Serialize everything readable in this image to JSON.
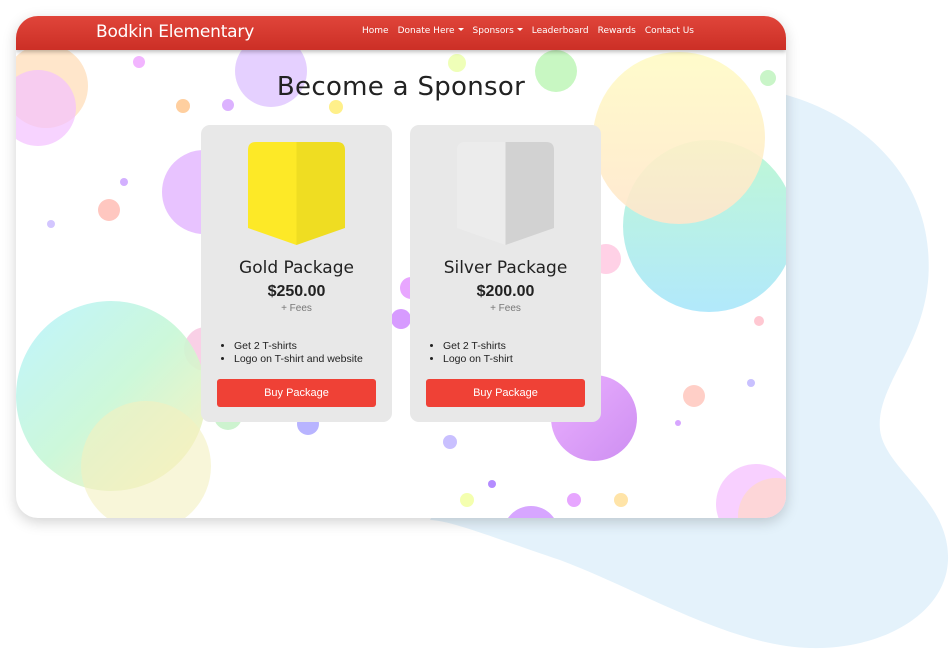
{
  "navbar": {
    "brand": "Bodkin Elementary",
    "items": [
      {
        "label": "Home",
        "has_dropdown": false
      },
      {
        "label": "Donate Here",
        "has_dropdown": true
      },
      {
        "label": "Sponsors",
        "has_dropdown": true
      },
      {
        "label": "Leaderboard",
        "has_dropdown": false
      },
      {
        "label": "Rewards",
        "has_dropdown": false
      },
      {
        "label": "Contact Us",
        "has_dropdown": false
      }
    ]
  },
  "page": {
    "title": "Become a Sponsor"
  },
  "packages": [
    {
      "name": "Gold Package",
      "price": "$250.00",
      "fees": "+ Fees",
      "icon": "gold-shield-icon",
      "features": [
        "Get 2 T-shirts",
        "Logo on T-shirt and website"
      ],
      "button_label": "Buy Package"
    },
    {
      "name": "Silver Package",
      "price": "$200.00",
      "fees": "+ Fees",
      "icon": "silver-shield-icon",
      "features": [
        "Get 2 T-shirts",
        "Logo on T-shirt"
      ],
      "button_label": "Buy Package"
    }
  ],
  "colors": {
    "navbar": "#d9382f",
    "button": "#ef4136",
    "card": "#e8e8e8",
    "gold_light": "#fde927",
    "gold_dark": "#efdd22",
    "silver_light": "#ececec",
    "silver_dark": "#d2d2d2",
    "backdrop_blob": "#e4f2fb"
  }
}
